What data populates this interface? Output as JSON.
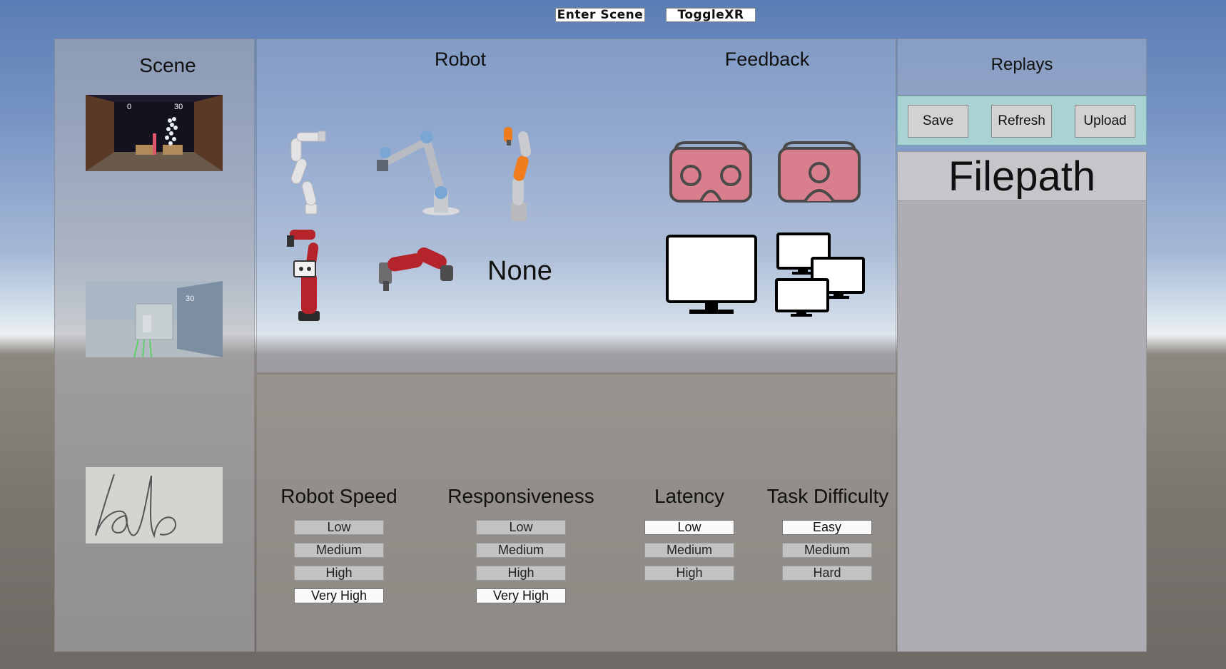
{
  "top": {
    "enter_scene": "Enter Scene",
    "toggle_xr": "ToggleXR"
  },
  "scene": {
    "title": "Scene",
    "thumbs": [
      {
        "name": "scene-thumb-shelf",
        "score_left": "0",
        "score_right": "30"
      },
      {
        "name": "scene-thumb-room",
        "score": "30"
      },
      {
        "name": "scene-thumb-lab"
      }
    ]
  },
  "robot": {
    "title": "Robot",
    "none_label": "None"
  },
  "feedback": {
    "title": "Feedback"
  },
  "params": {
    "robot_speed": {
      "title": "Robot Speed",
      "options": [
        "Low",
        "Medium",
        "High",
        "Very High"
      ],
      "selected": "Very High"
    },
    "responsiveness": {
      "title": "Responsiveness",
      "options": [
        "Low",
        "Medium",
        "High",
        "Very High"
      ],
      "selected": "Very High"
    },
    "latency": {
      "title": "Latency",
      "options": [
        "Low",
        "Medium",
        "High"
      ],
      "selected": "Low"
    },
    "task_difficulty": {
      "title": "Task Difficulty",
      "options": [
        "Easy",
        "Medium",
        "Hard"
      ],
      "selected": "Easy"
    }
  },
  "replays": {
    "title": "Replays",
    "save": "Save",
    "refresh": "Refresh",
    "upload": "Upload",
    "filepath": "Filepath"
  },
  "colors": {
    "vr_headset": "#d87e8c",
    "vr_outline": "#4a4a4a",
    "robot_red": "#b5242a",
    "robot_orange": "#f07c1e",
    "robot_blue": "#7aa6d6"
  }
}
